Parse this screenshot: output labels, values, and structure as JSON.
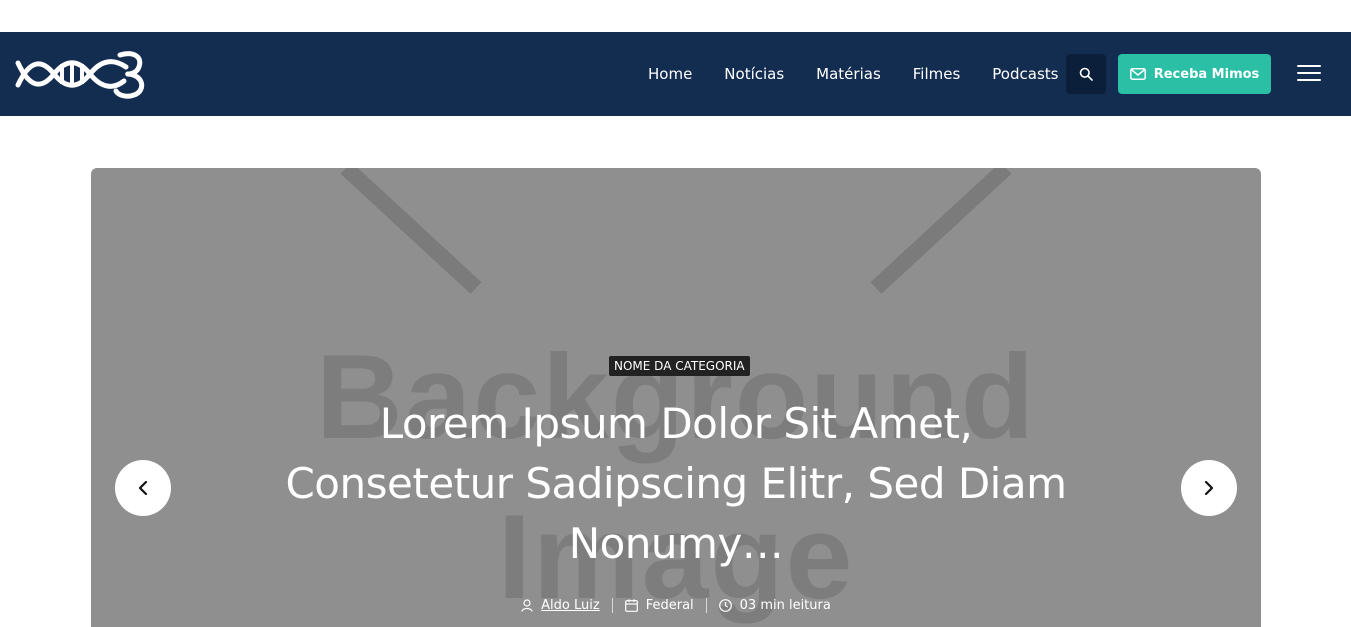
{
  "nav": {
    "links": [
      "Home",
      "Notícias",
      "Matérias",
      "Filmes",
      "Podcasts"
    ],
    "cta_label": "Receba Mimos",
    "colors": {
      "navbar": "#132d51",
      "cta": "#2bbfa6",
      "search": "#0c1f3a"
    },
    "icons": {
      "logo": "dna-logo",
      "search": "search-icon",
      "mail": "mail-icon",
      "menu": "hamburger-icon"
    }
  },
  "hero": {
    "placeholder_line1": "Background",
    "placeholder_line2": "Image",
    "category": "NOME DA CATEGORIA",
    "title": "Lorem Ipsum Dolor Sit Amet, Consetetur Sadipscing Elitr, Sed Diam Nonumy…",
    "author": "Aldo Luiz",
    "section": "Federal",
    "read_time": "03 min leitura",
    "icons": {
      "prev": "chevron-left-icon",
      "next": "chevron-right-icon",
      "author": "user-icon",
      "section": "calendar-icon",
      "time": "clock-icon"
    }
  }
}
